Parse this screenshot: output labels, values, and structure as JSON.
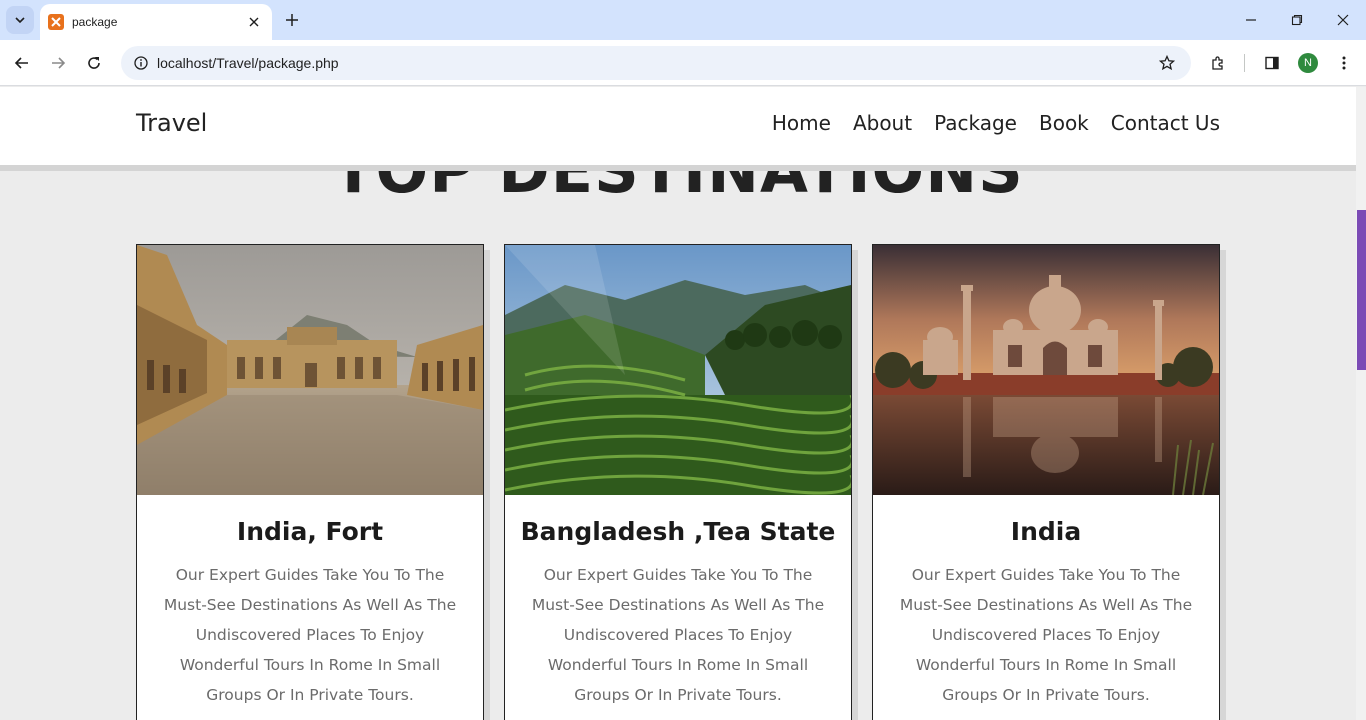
{
  "browser": {
    "tab_title": "package",
    "url": "localhost/Travel/package.php",
    "profile_initial": "N",
    "tab_favicon_color": "#e8711c",
    "profile_color": "#2f8a3e"
  },
  "site": {
    "brand": "Travel",
    "nav": [
      "Home",
      "About",
      "Package",
      "Book",
      "Contact Us"
    ],
    "heading": "TOP DESTINATIONS"
  },
  "cards": [
    {
      "title": "India, Fort",
      "text": "Our Expert Guides Take You To The Must-See Destinations As Well As The Undiscovered Places To Enjoy Wonderful Tours In Rome In Small Groups Or In Private Tours.",
      "image": "fort-courtyard-photo"
    },
    {
      "title": "Bangladesh ,Tea State",
      "text": "Our Expert Guides Take You To The Must-See Destinations As Well As The Undiscovered Places To Enjoy Wonderful Tours In Rome In Small Groups Or In Private Tours.",
      "image": "tea-plantation-photo"
    },
    {
      "title": "India",
      "text": "Our Expert Guides Take You To The Must-See Destinations As Well As The Undiscovered Places To Enjoy Wonderful Tours In Rome In Small Groups Or In Private Tours.",
      "image": "taj-mahal-photo"
    }
  ],
  "colors": {
    "scroll_thumb": "#7b4bb5",
    "page_bg": "#ececec"
  }
}
